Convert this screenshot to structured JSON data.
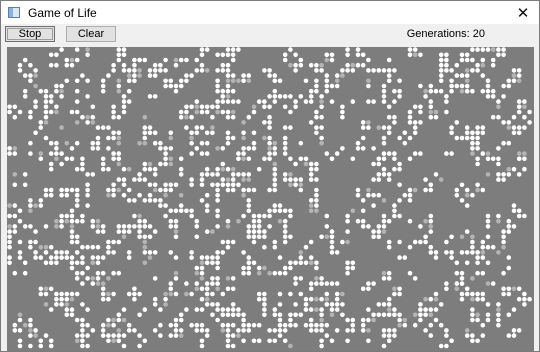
{
  "window": {
    "title": "Game of Life",
    "icon": "app-window-icon",
    "close_glyph": "✕"
  },
  "toolbar": {
    "stop_label": "Stop",
    "clear_label": "Clear",
    "generations_text": "Generations: 20"
  },
  "board": {
    "background_color": "#7d7d7d",
    "live_cell_color": "#ffffff",
    "dim_cell_color": "#b4b4b4",
    "seed": 20
  }
}
